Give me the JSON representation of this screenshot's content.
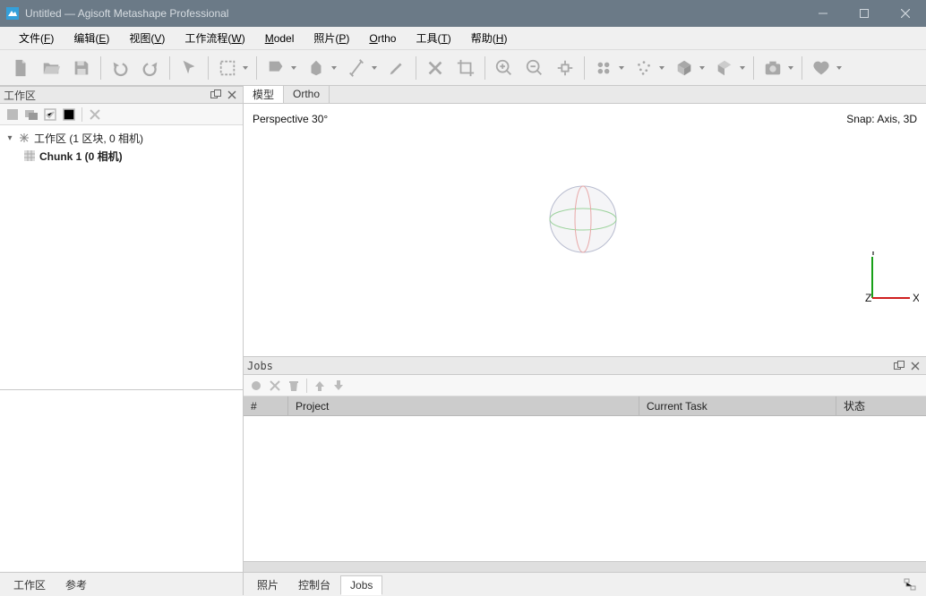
{
  "window": {
    "title": "Untitled — Agisoft Metashape Professional"
  },
  "menu": {
    "file": "文件(F)",
    "edit": "编辑(E)",
    "view": "视图(V)",
    "workflow": "工作流程(W)",
    "model": "Model",
    "photo": "照片(P)",
    "ortho": "Ortho",
    "tools": "工具(T)",
    "help": "帮助(H)"
  },
  "workspace": {
    "title": "工作区",
    "root": "工作区 (1 区块, 0 相机)",
    "chunk": "Chunk 1 (0 相机)"
  },
  "viewport": {
    "tabs": {
      "model": "模型",
      "ortho": "Ortho"
    },
    "perspective": "Perspective 30°",
    "snap": "Snap: Axis, 3D",
    "axis": {
      "x": "X",
      "y": "Y",
      "z": "Z"
    }
  },
  "jobs": {
    "title": "Jobs",
    "cols": {
      "num": "#",
      "project": "Project",
      "task": "Current Task",
      "status": "状态"
    }
  },
  "bottom_tabs": {
    "left": {
      "workspace": "工作区",
      "reference": "参考"
    },
    "right": {
      "photos": "照片",
      "console": "控制台",
      "jobs": "Jobs"
    }
  }
}
